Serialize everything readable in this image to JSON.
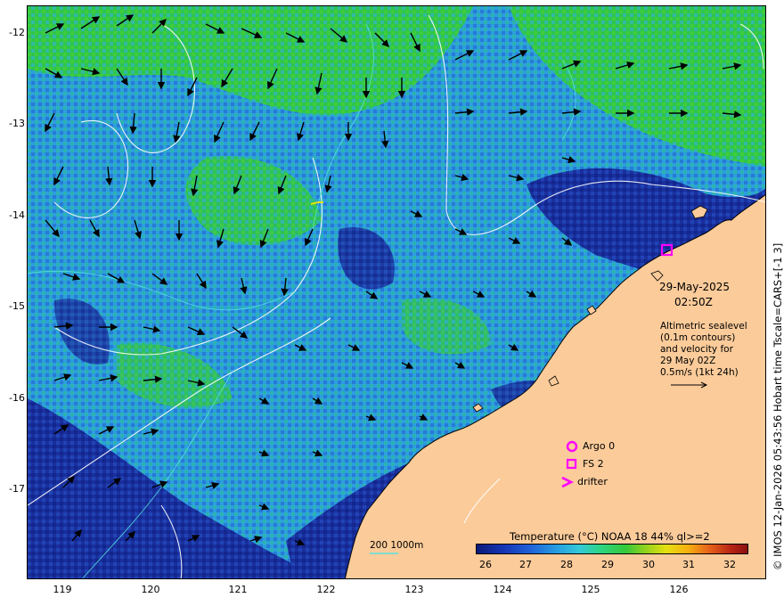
{
  "map": {
    "lat_ticks": [
      "-12",
      "-13",
      "-14",
      "-15",
      "-16",
      "-17"
    ],
    "lon_ticks": [
      "119",
      "120",
      "121",
      "122",
      "123",
      "124",
      "125",
      "126"
    ],
    "date": "29-May-2025",
    "time": "02:50Z",
    "description": [
      "Altimetric sealevel",
      "(0.1m contours)",
      "and velocity for",
      "29 May 02Z",
      "0.5m/s (1kt 24h)"
    ],
    "legend": {
      "argo_label": "Argo 0",
      "fs_label": "FS 2",
      "drifter_label": "drifter"
    },
    "scale_bar": "200  1000m",
    "colorbar": {
      "title": "Temperature (°C) NOAA 18 44% ql>=2",
      "ticks": [
        "26",
        "27",
        "28",
        "29",
        "30",
        "31",
        "32"
      ],
      "range": [
        25.6,
        32.6
      ]
    },
    "credit": "© IMOS 12-Jan-2026 05:43:56 Hobart time Tscale=CARS+[-1 3]",
    "colors": {
      "land": "#fbcb9a",
      "deep_water": "#1a2f9e",
      "warm_water": "#2fa6e0",
      "green_water": "#2bc64d",
      "marker": "#ff00ff"
    }
  }
}
